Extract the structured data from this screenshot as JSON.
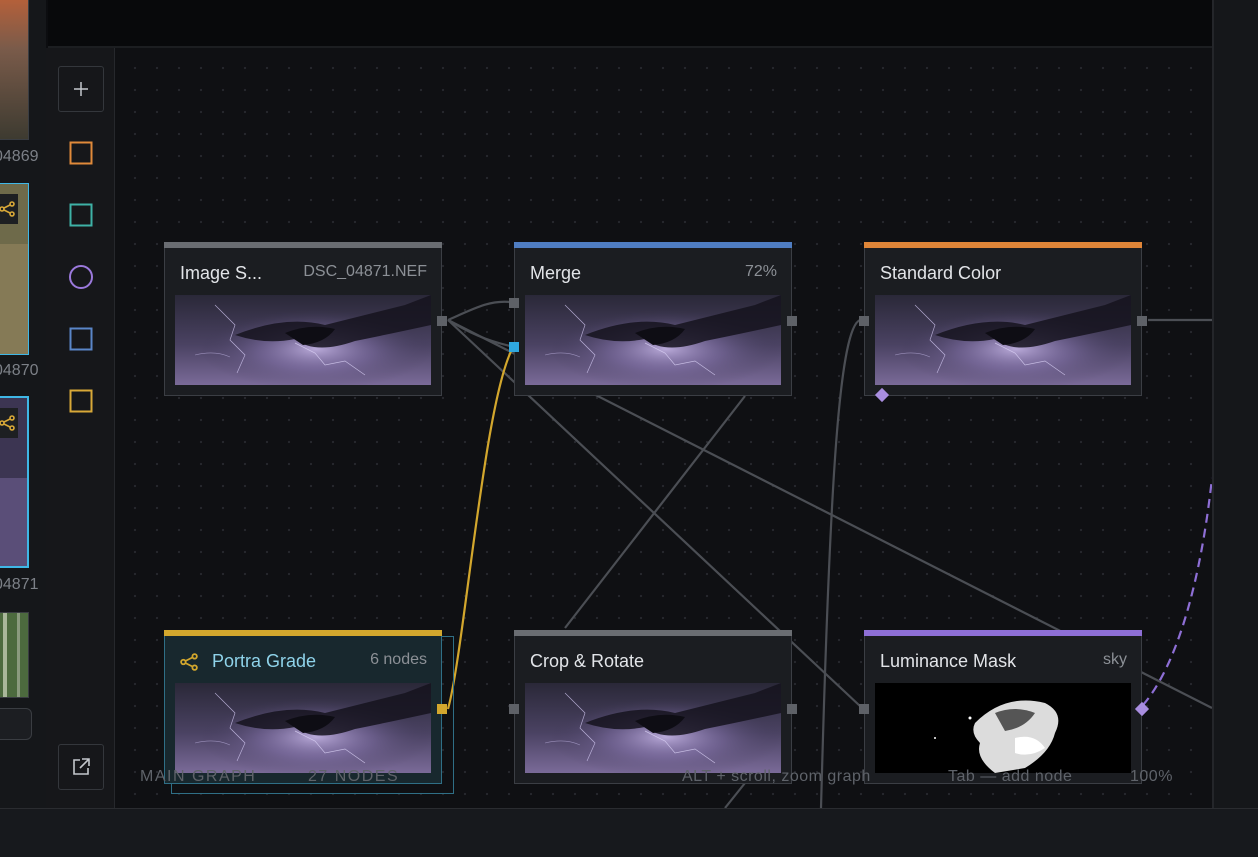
{
  "filmstrip": {
    "items": [
      {
        "label": "04869"
      },
      {
        "label": "04870"
      },
      {
        "label": "04871"
      }
    ]
  },
  "tool_rail": {
    "tools": [
      {
        "name": "add",
        "icon": "plus-icon"
      },
      {
        "name": "color-node",
        "icon": "orange-square-icon",
        "color": "#e08a3a"
      },
      {
        "name": "detail-node",
        "icon": "teal-square-icon",
        "color": "#3eb2a6"
      },
      {
        "name": "mask-node",
        "icon": "purple-circle-icon",
        "color": "#9b79dc"
      },
      {
        "name": "io-node",
        "icon": "blue-square-icon",
        "color": "#5a86c8"
      },
      {
        "name": "group-node",
        "icon": "yellow-square-icon",
        "color": "#d8a838"
      },
      {
        "name": "export",
        "icon": "external-link-icon"
      }
    ]
  },
  "nodes": {
    "image_source": {
      "title": "Image S...",
      "meta": "DSC_04871.NEF",
      "accent": "#6a6d72"
    },
    "merge": {
      "title": "Merge",
      "meta": "72%",
      "accent": "#4f7dc2"
    },
    "standard_color": {
      "title": "Standard Color",
      "meta": "",
      "accent": "#df8538"
    },
    "portra_grade": {
      "title": "Portra Grade",
      "meta": "6 nodes",
      "accent": "#d3a72d"
    },
    "crop_rotate": {
      "title": "Crop & Rotate",
      "meta": "",
      "accent": "#6a6d72"
    },
    "luminance_mask": {
      "title": "Luminance Mask",
      "meta": "sky",
      "accent": "#8e6fd6"
    }
  },
  "status_bar": {
    "graph_name": "MAIN GRAPH",
    "node_count": "27 NODES",
    "hint_zoom": "ALT + scroll, zoom graph",
    "hint_add": "Tab — add node",
    "zoom": "100%"
  }
}
